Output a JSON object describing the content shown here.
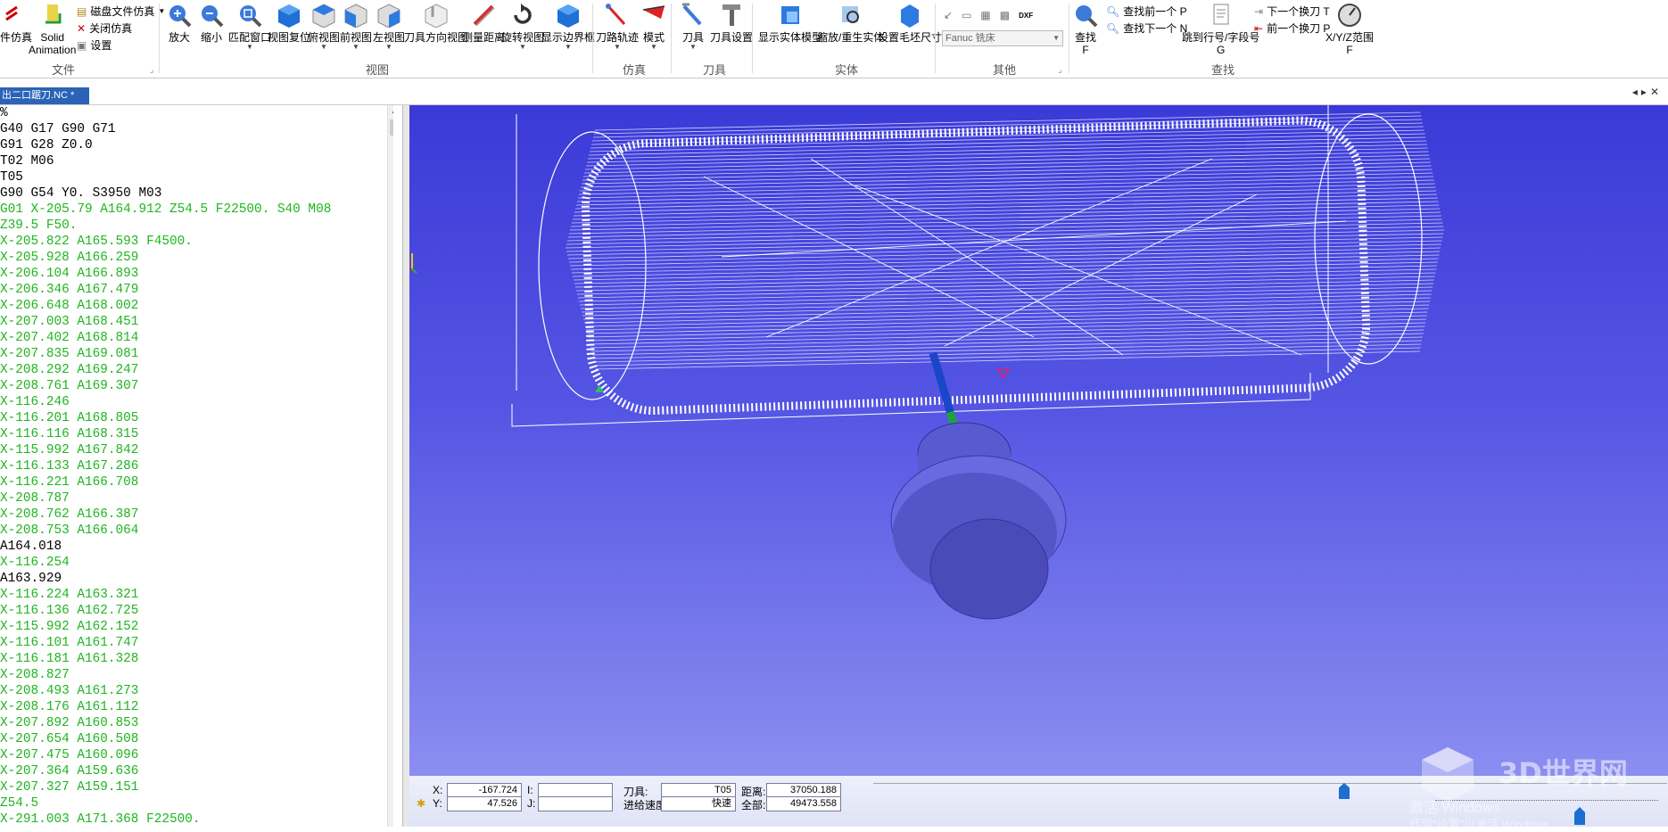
{
  "ribbon": {
    "file_group": {
      "sim_cut": "件仿真",
      "solid_animation": "Solid\nAnimation",
      "disk_sim": "磁盘文件仿真",
      "close_sim": "关闭仿真",
      "settings": "设置",
      "group_label": "文件"
    },
    "view_group": {
      "zoom_in": "放大",
      "zoom_out": "缩小",
      "fit_window": "匹配窗口",
      "view_reset": "视图复位",
      "top_view": "俯视图",
      "front_view": "前视图",
      "left_view": "左视图",
      "tool_dir_view": "刀具方向视图",
      "measure": "测量距离",
      "rotate_view": "旋转视图",
      "show_bounds": "显示边界框",
      "group_label": "视图"
    },
    "sim_group": {
      "toolpath": "刀路轨迹",
      "mode": "模式",
      "group_label": "仿真"
    },
    "tool_group": {
      "tool": "刀具",
      "tool_setup": "刀具设置",
      "group_label": "刀具"
    },
    "solid_group": {
      "show_solid": "显示实体模型",
      "zoom_rebuild": "缩放/重生实体",
      "stock_size": "设置毛坯尺寸",
      "group_label": "实体"
    },
    "other_group": {
      "machine_select": "Fanuc 铣床",
      "dxf": "DXF",
      "group_label": "其他"
    },
    "find_group": {
      "find": "查找\nF",
      "find_prev": "查找前一个 P",
      "find_next": "查找下一个 N",
      "goto_line": "跳到行号/字段号\nG",
      "next_tool": "下一个换刀 T",
      "prev_tool": "前一个换刀 P",
      "xyz_range": "X/Y/Z范围\nF",
      "group_label": "查找"
    }
  },
  "tab": {
    "title": "出二口踞刀.NC *"
  },
  "code_lines": [
    {
      "t": "%",
      "c": "#000"
    },
    {
      "t": "G40 G17 G90 G71",
      "c": "#000"
    },
    {
      "t": "G91 G28 Z0.0",
      "c": "#000"
    },
    {
      "t": "T02 M06",
      "c": "#000"
    },
    {
      "t": "T05",
      "c": "#000"
    },
    {
      "t": "G90 G54 Y0. S3950 M03",
      "c": "#000"
    },
    {
      "t": "G01 X-205.79 A164.912 Z54.5 F22500. S40 M08",
      "c": "#1fb51f"
    },
    {
      "t": "Z39.5 F50.",
      "c": "#1fb51f"
    },
    {
      "t": "X-205.822 A165.593 F4500.",
      "c": "#1fb51f"
    },
    {
      "t": "X-205.928 A166.259",
      "c": "#1fb51f"
    },
    {
      "t": "X-206.104 A166.893",
      "c": "#1fb51f"
    },
    {
      "t": "X-206.346 A167.479",
      "c": "#1fb51f"
    },
    {
      "t": "X-206.648 A168.002",
      "c": "#1fb51f"
    },
    {
      "t": "X-207.003 A168.451",
      "c": "#1fb51f"
    },
    {
      "t": "X-207.402 A168.814",
      "c": "#1fb51f"
    },
    {
      "t": "X-207.835 A169.081",
      "c": "#1fb51f"
    },
    {
      "t": "X-208.292 A169.247",
      "c": "#1fb51f"
    },
    {
      "t": "X-208.761 A169.307",
      "c": "#1fb51f"
    },
    {
      "t": "X-116.246",
      "c": "#1fb51f"
    },
    {
      "t": "X-116.201 A168.805",
      "c": "#1fb51f"
    },
    {
      "t": "X-116.116 A168.315",
      "c": "#1fb51f"
    },
    {
      "t": "X-115.992 A167.842",
      "c": "#1fb51f"
    },
    {
      "t": "X-116.133 A167.286",
      "c": "#1fb51f"
    },
    {
      "t": "X-116.221 A166.708",
      "c": "#1fb51f"
    },
    {
      "t": "X-208.787",
      "c": "#1fb51f"
    },
    {
      "t": "X-208.762 A166.387",
      "c": "#1fb51f"
    },
    {
      "t": "X-208.753 A166.064",
      "c": "#1fb51f"
    },
    {
      "t": "A164.018",
      "c": "#000"
    },
    {
      "t": "X-116.254",
      "c": "#1fb51f"
    },
    {
      "t": "A163.929",
      "c": "#000"
    },
    {
      "t": "X-116.224 A163.321",
      "c": "#1fb51f"
    },
    {
      "t": "X-116.136 A162.725",
      "c": "#1fb51f"
    },
    {
      "t": "X-115.992 A162.152",
      "c": "#1fb51f"
    },
    {
      "t": "X-116.101 A161.747",
      "c": "#1fb51f"
    },
    {
      "t": "X-116.181 A161.328",
      "c": "#1fb51f"
    },
    {
      "t": "X-208.827",
      "c": "#1fb51f"
    },
    {
      "t": "X-208.493 A161.273",
      "c": "#1fb51f"
    },
    {
      "t": "X-208.176 A161.112",
      "c": "#1fb51f"
    },
    {
      "t": "X-207.892 A160.853",
      "c": "#1fb51f"
    },
    {
      "t": "X-207.654 A160.508",
      "c": "#1fb51f"
    },
    {
      "t": "X-207.475 A160.096",
      "c": "#1fb51f"
    },
    {
      "t": "X-207.364 A159.636",
      "c": "#1fb51f"
    },
    {
      "t": "X-207.327 A159.151",
      "c": "#1fb51f"
    },
    {
      "t": "Z54.5",
      "c": "#1fb51f"
    },
    {
      "t": "X-291.003 A171.368 F22500.",
      "c": "#1fb51f"
    }
  ],
  "status": {
    "x_label": "X:",
    "x_value": "-167.724",
    "y_label": "Y:",
    "y_value": "47.526",
    "i_label": "I:",
    "i_value": "",
    "j_label": "J:",
    "j_value": "",
    "tool_label": "刀具:",
    "tool_value": "T05",
    "feed_label": "进给速度:",
    "feed_value": "快速",
    "dist_label": "距离:",
    "dist_value": "37050.188",
    "total_label": "全部:",
    "total_value": "49473.558"
  },
  "watermark": {
    "brand": "3D世界网",
    "activate": "激活 Windows",
    "activate_hint": "转到\"设置\"以激活 Windows"
  },
  "colors": {
    "accent": "#2b63b6",
    "code_green": "#1fb51f",
    "viewport_top": "#3a3ad8",
    "viewport_bottom": "#8b8ef0"
  }
}
